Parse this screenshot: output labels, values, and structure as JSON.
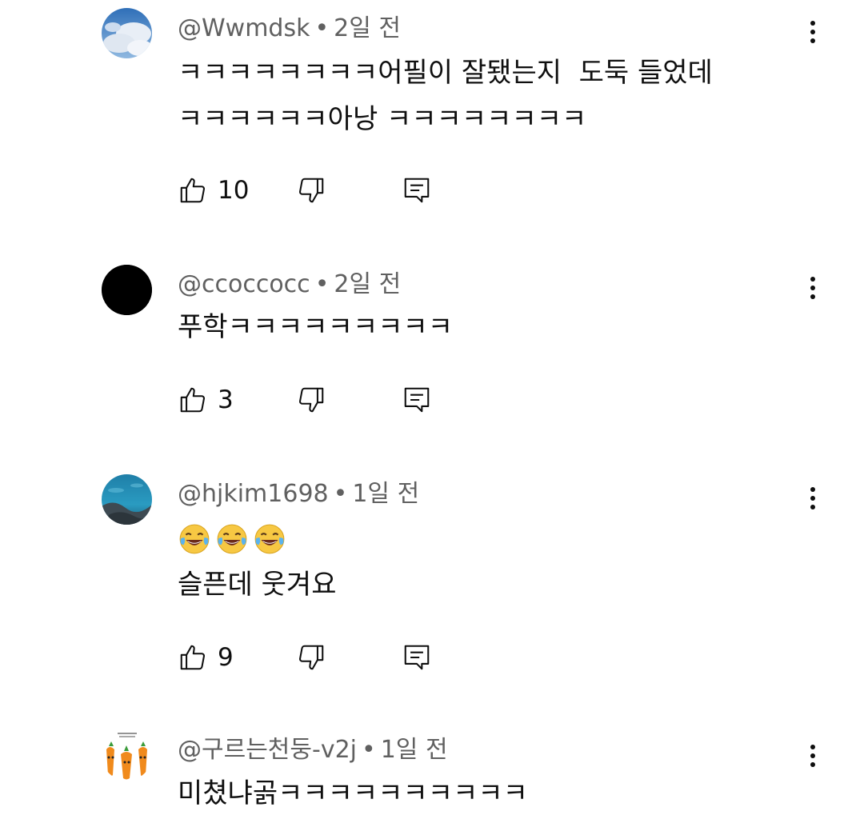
{
  "comments": [
    {
      "handle": "@Wwmdsk",
      "separator": "•",
      "time": "2일 전",
      "lines": [
        "ㅋㅋㅋㅋㅋㅋㅋㅋ어필이 잘됐는지  도둑 들었데",
        "ㅋㅋㅋㅋㅋㅋ아낭 ㅋㅋㅋㅋㅋㅋㅋㅋ"
      ],
      "likes": "10",
      "avatar": "sky-clouds-avatar"
    },
    {
      "handle": "@ccoccocc",
      "separator": "•",
      "time": "2일 전",
      "lines": [
        "푸학ㅋㅋㅋㅋㅋㅋㅋㅋㅋ"
      ],
      "likes": "3",
      "avatar": "black-circle-avatar"
    },
    {
      "handle": "@hjkim1698",
      "separator": "•",
      "time": "1일 전",
      "emojis": [
        "face-with-tears-of-joy",
        "face-with-tears-of-joy",
        "face-with-tears-of-joy"
      ],
      "lines": [
        "슬픈데 웃겨요"
      ],
      "likes": "9",
      "avatar": "sea-rocks-avatar"
    },
    {
      "handle": "@구르는천둥-v2j",
      "separator": "•",
      "time": "1일 전",
      "lines": [
        "미쳤냐곩ㅋㅋㅋㅋㅋㅋㅋㅋㅋㅋ"
      ],
      "avatar": "carrot-characters-avatar"
    }
  ],
  "colors": {
    "text_primary": "#0f0f0f",
    "text_secondary": "#606060",
    "background": "#ffffff"
  },
  "icons": {
    "like": "thumbs-up-icon",
    "dislike": "thumbs-down-icon",
    "reply": "reply-comment-icon",
    "more": "more-vert-icon"
  }
}
